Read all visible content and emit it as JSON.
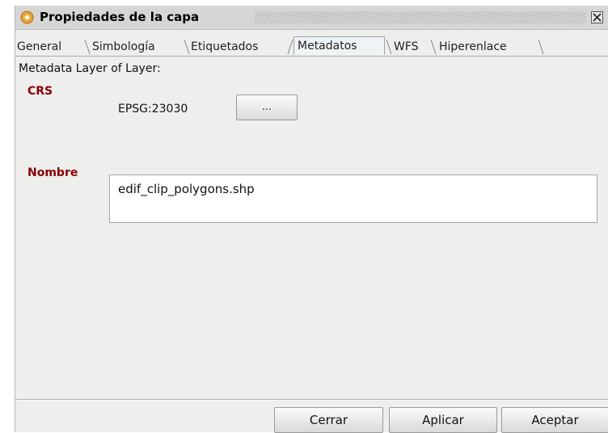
{
  "window": {
    "title": "Propiedades de la capa"
  },
  "tabs": [
    {
      "label": "General",
      "active": false
    },
    {
      "label": "Simbología",
      "active": false
    },
    {
      "label": "Etiquetados",
      "active": false
    },
    {
      "label": "Metadatos",
      "active": true
    },
    {
      "label": "WFS",
      "active": false
    },
    {
      "label": "Hiperenlace",
      "active": false
    }
  ],
  "metadata": {
    "header": "Metadata Layer of Layer:",
    "crs_label": "CRS",
    "crs_value": "EPSG:23030",
    "crs_button": "...",
    "name_label": "Nombre",
    "name_value": "edif_clip_polygons.shp"
  },
  "footer": {
    "close_label": "Cerrar",
    "apply_label": "Aplicar",
    "accept_label": "Aceptar"
  },
  "colors": {
    "field_label": "#8b0000",
    "dialog_bg": "#eeeeec",
    "active_tab_border": "#9aa7b4"
  },
  "icons": {
    "app": "qgis-gear-icon",
    "close": "close-icon"
  }
}
